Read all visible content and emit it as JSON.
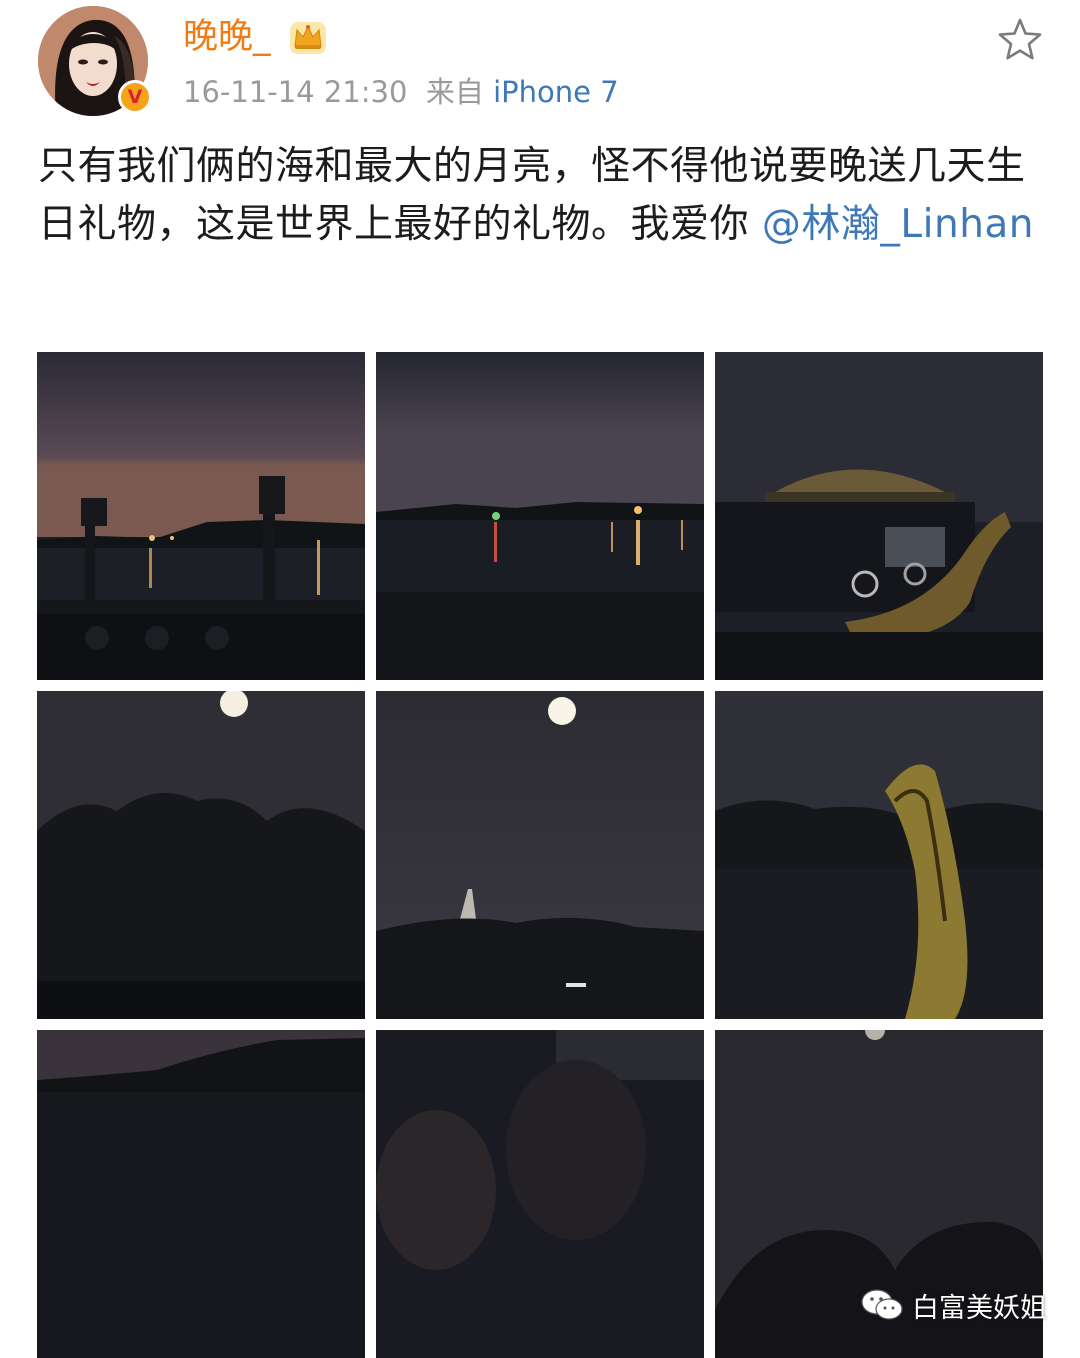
{
  "header": {
    "username": "晚晚_",
    "timestamp": "16-11-14 21:30",
    "source_prefix": "来自",
    "device": "iPhone 7",
    "verified_badge": "V"
  },
  "post": {
    "text": "只有我们俩的海和最大的月亮，怪不得他说要晚送几天生日礼物，这是世界上最好的礼物。我爱你 ",
    "mention": "@林瀚_Linhan"
  },
  "watermark": {
    "text": "白富美妖姐"
  },
  "colors": {
    "username": "#f27b12",
    "link": "#3f78b7",
    "meta": "#9a9a9a"
  },
  "photos": [
    {
      "subject": "night lake with posts and railing"
    },
    {
      "subject": "night lake with shore lights"
    },
    {
      "subject": "dragon boat at night"
    },
    {
      "subject": "moon over dark trees"
    },
    {
      "subject": "moon over white pagoda"
    },
    {
      "subject": "dragon boat head by the water"
    },
    {
      "subject": "dark lake shoreline"
    },
    {
      "subject": "dark selfie by the lake"
    },
    {
      "subject": "moon above silhouettes"
    }
  ]
}
